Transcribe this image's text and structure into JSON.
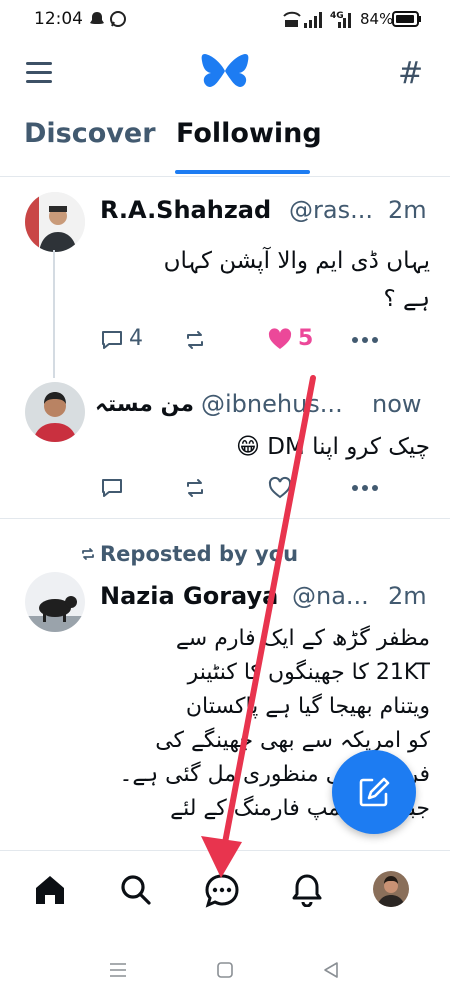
{
  "status_bar": {
    "time": "12:04",
    "battery": "84%",
    "network": "4G"
  },
  "header": {
    "menu_icon": "hamburger-icon",
    "logo": "butterfly-logo",
    "feeds_icon": "hashtag-icon"
  },
  "tabs": [
    {
      "label": "Discover"
    },
    {
      "label": "Following"
    }
  ],
  "posts": [
    {
      "author": "R.A.Shahzad",
      "handle": "@ras...",
      "time": "2m",
      "text_line1": "یہاں ڈی ایم والا آپشن کہاں",
      "text_line2": "ہے ؟",
      "replies": "4",
      "likes": "5"
    },
    {
      "author": "من مستہ",
      "handle": "@ibnehus...",
      "time": "now",
      "text": "چیک کرو اپنا DM 😁"
    },
    {
      "reposted_by": "Reposted by you",
      "author": "Nazia Goraya",
      "handle": "@na...",
      "time": "2m",
      "lines": [
        "مظفر گڑھ کے ایک فارم سے",
        "21KT کا جھینگوں کا کنٹینر",
        "ویتنام بھیجا گیا ہے   پاکستان",
        "کو امریکہ سے بھی جھینگے کی",
        "فروخت کی منظوری مل گئی ہے۔",
        "جبکہ شریمپ فارمنگ کے لئے"
      ]
    }
  ],
  "bottom_nav": [
    "home-icon",
    "search-icon",
    "chat-icon",
    "bell-icon",
    "profile-avatar"
  ],
  "colors": {
    "accent": "#1d7cf2",
    "like": "#ec4899",
    "annotation_arrow": "#e8344e"
  }
}
